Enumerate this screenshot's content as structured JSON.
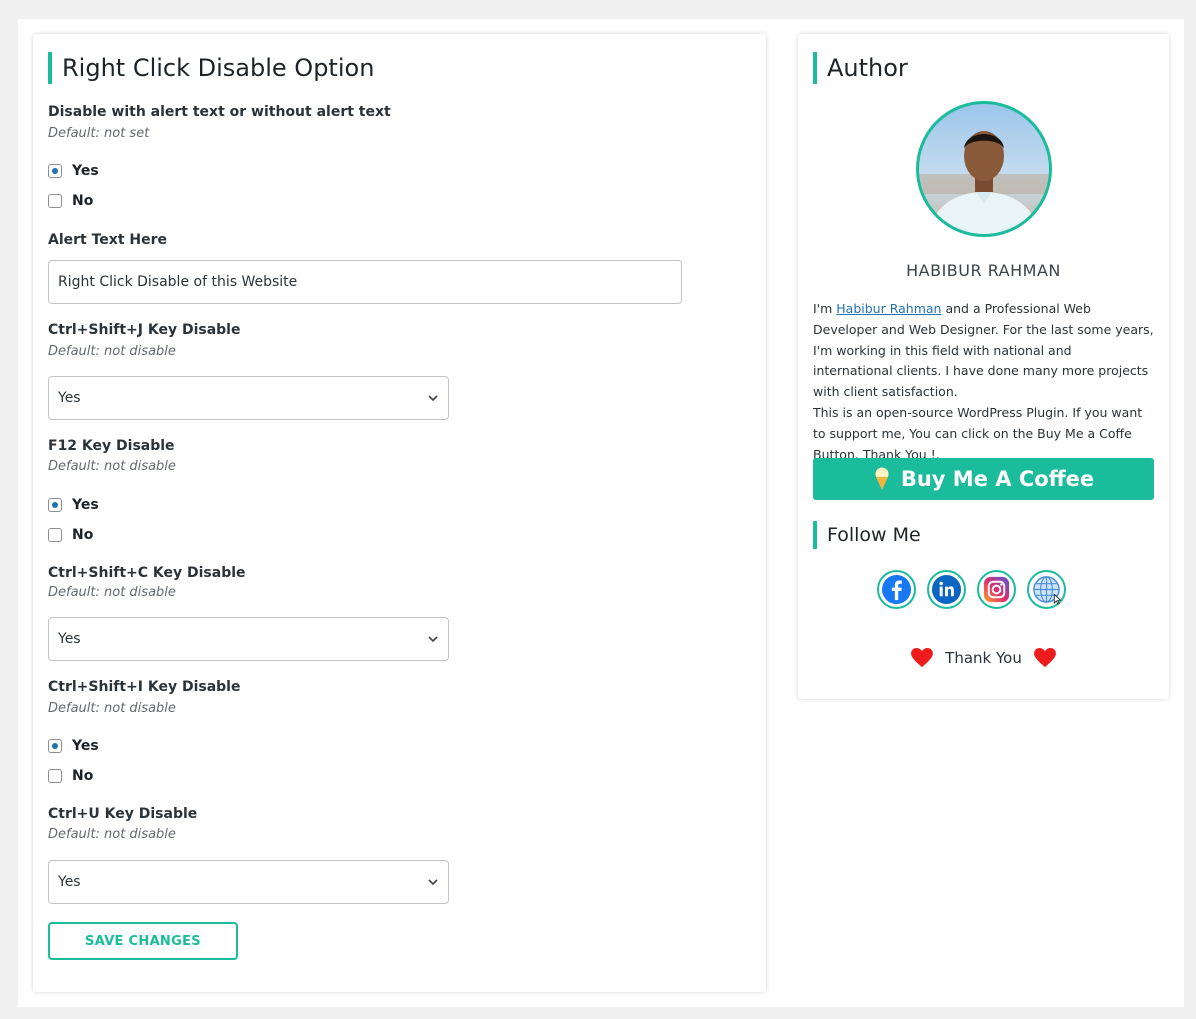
{
  "settings": {
    "title": "Right Click Disable Option",
    "alert_option": {
      "title": "Disable with alert text or without alert text",
      "default": "Default: not set",
      "yes_label": "Yes",
      "no_label": "No",
      "selected": "Yes"
    },
    "alert_text": {
      "title": "Alert Text Here",
      "value": "Right Click Disable of this Website"
    },
    "ctrl_shift_j": {
      "title": "Ctrl+Shift+J Key Disable",
      "default": "Default: not disable",
      "selected": "Yes"
    },
    "f12": {
      "title": "F12 Key Disable",
      "default": "Default: not disable",
      "yes_label": "Yes",
      "no_label": "No",
      "selected": "Yes"
    },
    "ctrl_shift_c": {
      "title": "Ctrl+Shift+C Key Disable",
      "default": "Default: not disable",
      "selected": "Yes"
    },
    "ctrl_shift_i": {
      "title": "Ctrl+Shift+I Key Disable",
      "default": "Default: not disable",
      "yes_label": "Yes",
      "no_label": "No",
      "selected": "Yes"
    },
    "ctrl_u": {
      "title": "Ctrl+U Key Disable",
      "default": "Default: not disable",
      "selected": "Yes"
    },
    "save_label": "SAVE CHANGES"
  },
  "author": {
    "title": "Author",
    "name": "HABIBUR RAHMAN",
    "bio_prefix": "I'm ",
    "bio_link": "Habibur Rahman",
    "bio_rest": " and a Professional Web Developer and Web Designer. For the last some years, I'm working in this field with national and international clients. I have done many more projects with client satisfaction.",
    "bio_second": "This is an open-source WordPress Plugin. If you want to support me, You can click on the Buy Me a Coffe Button. Thank You !.",
    "coffee_label": "Buy Me A Coffee",
    "follow_title": "Follow Me",
    "social": [
      "facebook-icon",
      "linkedin-icon",
      "instagram-icon",
      "globe-icon"
    ],
    "thanks_label": "Thank You"
  },
  "colors": {
    "accent": "#1bbc9b",
    "link": "#2271b1",
    "heart": "#ee1c1c"
  }
}
